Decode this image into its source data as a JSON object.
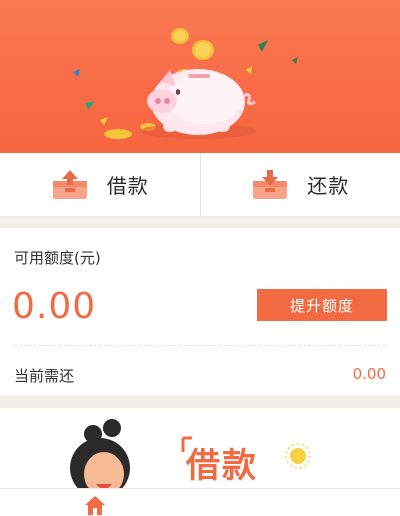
{
  "actions": {
    "borrow_label": "借款",
    "repay_label": "还款"
  },
  "credit": {
    "title": "可用额度(元)",
    "amount": "0.00",
    "raise_button": "提升额度",
    "due_label": "当前需还",
    "due_value": "0.00"
  },
  "promo": {
    "text": "借款"
  },
  "colors": {
    "accent": "#f26a42",
    "hero_top": "#fb7a52",
    "coin": "#f7c23c"
  },
  "icons": {
    "borrow": "tray-upload-icon",
    "repay": "tray-download-icon",
    "home": "home-icon",
    "hero": "piggy-bank-illustration"
  }
}
